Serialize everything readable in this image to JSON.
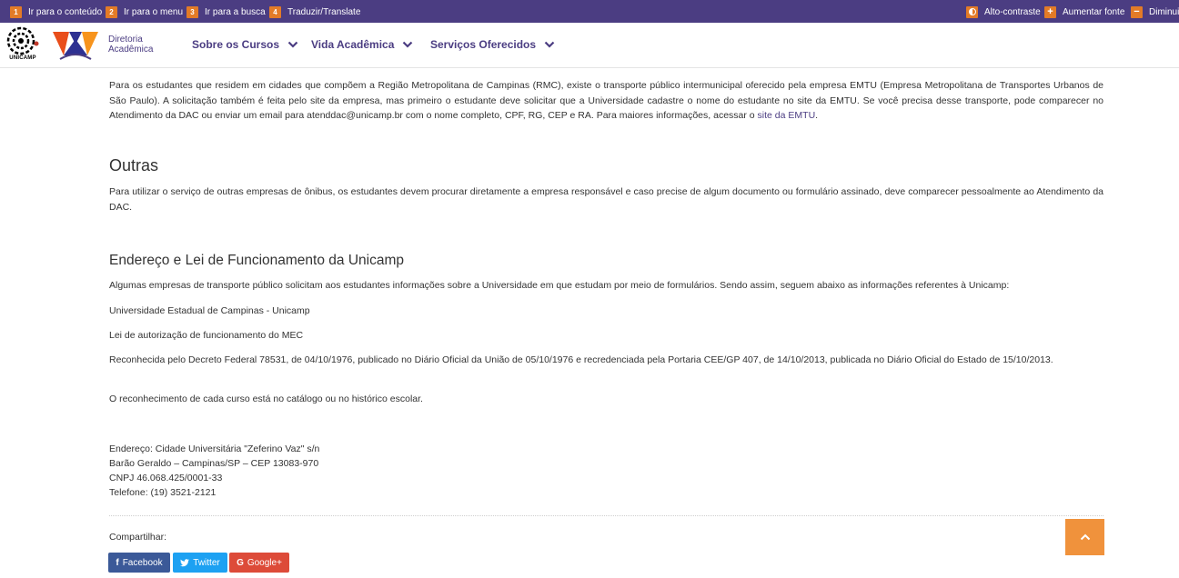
{
  "a11y": {
    "skip_content": {
      "key": "1",
      "label": "Ir para o conteúdo"
    },
    "skip_menu": {
      "key": "2",
      "label": "Ir para o menu"
    },
    "skip_search": {
      "key": "3",
      "label": "Ir para a busca"
    },
    "translate": {
      "key": "4",
      "label": "Traduzir/Translate"
    },
    "contrast_label": "Alto-contraste",
    "increase_font": {
      "icon": "+",
      "label": "Aumentar fonte"
    },
    "decrease_font": {
      "icon": "−",
      "label": "Diminuir fonte"
    }
  },
  "header": {
    "unicamp_label": "UNICAMP",
    "dac_line1": "Diretoria",
    "dac_line2": "Acadêmica",
    "nav": [
      {
        "label": "Sobre os Cursos"
      },
      {
        "label": "Vida Acadêmica"
      },
      {
        "label": "Serviços Oferecidos"
      }
    ]
  },
  "content": {
    "emtu_text_before": "Para os estudantes que residem em cidades que compõem a Região Metropolitana de Campinas (RMC), existe o transporte público intermunicipal oferecido pela empresa EMTU (Empresa Metropolitana de Transportes Urbanos de São Paulo). A solicitação também é feita pelo site da empresa, mas primeiro o estudante deve solicitar que a Universidade cadastre o nome do estudante no site da EMTU. Se você precisa desse transporte, pode comparecer no Atendimento da DAC ou enviar um email para atenddac@unicamp.br com o nome completo, CPF, RG, CEP e RA. Para maiores informações, acessar o ",
    "emtu_link": "site da EMTU",
    "emtu_text_after": ".",
    "outras_title": "Outras",
    "outras_text": "Para utilizar o serviço de outras empresas de ônibus, os estudantes devem procurar diretamente a empresa responsável e caso precise de algum documento ou formulário assinado, deve comparecer pessoalmente ao Atendimento da DAC.",
    "endereco_title": "Endereço e Lei de Funcionamento da Unicamp",
    "endereco_intro": "Algumas empresas de transporte público solicitam aos estudantes informações sobre a Universidade em que estudam por meio de formulários. Sendo assim, seguem abaixo as informações referentes à Unicamp:",
    "university_name": "Universidade Estadual de Campinas - Unicamp",
    "mec_law": "Lei de autorização de funcionamento do MEC",
    "decree": "Reconhecida pelo Decreto Federal 78531, de 04/10/1976, publicado no Diário Oficial da União de 05/10/1976 e recredenciada pela Portaria CEE/GP 407, de 14/10/2013, publicada no Diário Oficial do Estado de 15/10/2013.",
    "recognition": "O reconhecimento de cada curso está no catálogo ou no histórico escolar."
  },
  "address": {
    "line1": "Endereço: Cidade Universitária \"Zeferino Vaz\" s/n",
    "line2": "Barão Geraldo – Campinas/SP – CEP 13083-970",
    "line3": "CNPJ 46.068.425/0001-33",
    "line4": "Telefone: (19) 3521-2121"
  },
  "share": {
    "label": "Compartilhar:",
    "facebook": {
      "icon": "f",
      "label": "Facebook"
    },
    "twitter": {
      "icon": "🐦",
      "label": "Twitter"
    },
    "google": {
      "icon": "G",
      "label": "Google+"
    }
  },
  "colors": {
    "brand_purple": "#4b3d82",
    "accent_orange": "#e37b27",
    "facebook": "#3b5998",
    "twitter": "#1da1f2",
    "google": "#dd4b39"
  },
  "icons": {
    "back_to_top": "chevron-up-icon",
    "nav_dropdown": "chevron-down-icon",
    "contrast": "contrast-icon"
  }
}
